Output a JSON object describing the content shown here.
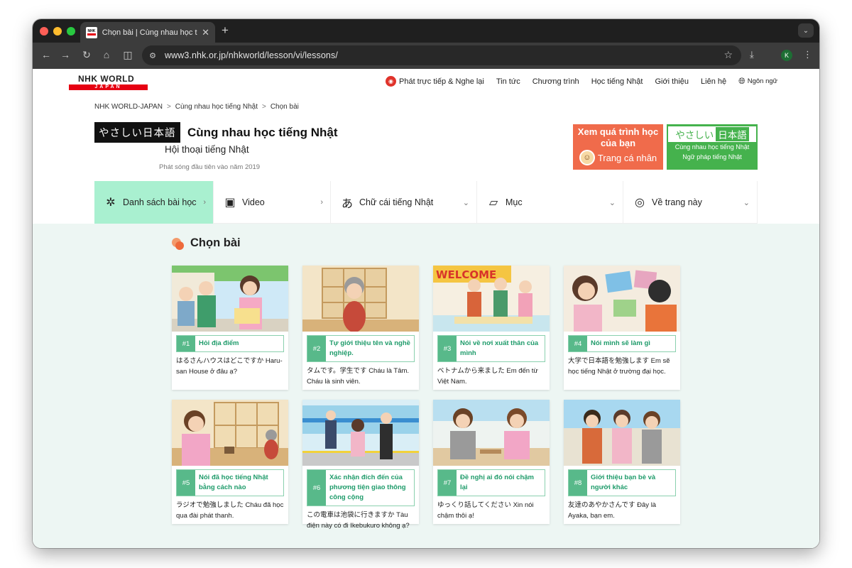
{
  "browser": {
    "tab_title": "Chọn bài | Cùng nhau học tiế",
    "tab_close": "✕",
    "new_tab": "+",
    "url": "www3.nhk.or.jp/nhkworld/lesson/vi/lessons/",
    "profile_initial": "K"
  },
  "site_header": {
    "logo_top": "NHK WORLD",
    "logo_bottom": "JAPAN",
    "nav": [
      {
        "label": "Phát trực tiếp & Nghe lại"
      },
      {
        "label": "Tin tức"
      },
      {
        "label": "Chương trình"
      },
      {
        "label": "Học tiếng Nhật"
      },
      {
        "label": "Giới thiệu"
      },
      {
        "label": "Liên hệ"
      }
    ],
    "language_label": "Ngôn ngữ"
  },
  "breadcrumb": [
    "NHK WORLD-JAPAN",
    "Cùng nhau học tiếng Nhật",
    "Chọn bài"
  ],
  "breadcrumb_sep": ">",
  "title": {
    "yasashii": "やさしい日本語",
    "main": "Cùng nhau học tiếng Nhật",
    "subtitle": "Hội thoại tiếng Nhật",
    "broadcast": "Phát sóng đầu tiên vào năm 2019"
  },
  "promo_orange": {
    "line1": "Xem quá trình học của bạn",
    "line2": "Trang cá nhân"
  },
  "promo_green": {
    "top_a": "やさしい",
    "top_b": "日本語",
    "line1": "Cùng nhau học tiếng Nhật",
    "line2": "Ngữ pháp tiếng Nhật"
  },
  "content_nav": [
    {
      "label": "Danh sách bài học",
      "icon": "lesson-list-icon",
      "active": true
    },
    {
      "label": "Video",
      "icon": "video-icon"
    },
    {
      "label": "Chữ cái tiếng Nhật",
      "icon": "kana-icon"
    },
    {
      "label": "Mục",
      "icon": "book-icon"
    },
    {
      "label": "Về trang này",
      "icon": "globe-icon"
    }
  ],
  "section_title": "Chọn bài",
  "lessons": [
    {
      "num": "#1",
      "title": "Hỏi địa điểm",
      "text": "はるさんハウスはどこですか Haru-san House ở đâu ạ?"
    },
    {
      "num": "#2",
      "title": "Tự giới thiệu tên và nghề nghiệp.",
      "text": "タムです。学生です Cháu là Tâm. Cháu là sinh viên."
    },
    {
      "num": "#3",
      "title": "Nói về nơi xuất thân của mình",
      "text": "ベトナムから来ました Em đến từ Việt Nam."
    },
    {
      "num": "#4",
      "title": "Nói mình sẽ làm gì",
      "text": "大学で日本語を勉強します Em sẽ học tiếng Nhật ở trường đại học."
    },
    {
      "num": "#5",
      "title": "Nói đã học tiếng Nhật bằng cách nào",
      "text": "ラジオで勉強しました Cháu đã học qua đài phát thanh."
    },
    {
      "num": "#6",
      "title": "Xác nhận đích đến của phương tiện giao thông công cộng",
      "text": "この電車は池袋に行きますか Tàu điện này có đi Ikebukuro không ạ?"
    },
    {
      "num": "#7",
      "title": "Đề nghị ai đó nói chậm lại",
      "text": "ゆっくり話してください Xin nói chậm thôi ạ!"
    },
    {
      "num": "#8",
      "title": "Giới thiệu bạn bè và người khác",
      "text": "友達のあやかさんです Đây là Ayaka, bạn em."
    }
  ]
}
